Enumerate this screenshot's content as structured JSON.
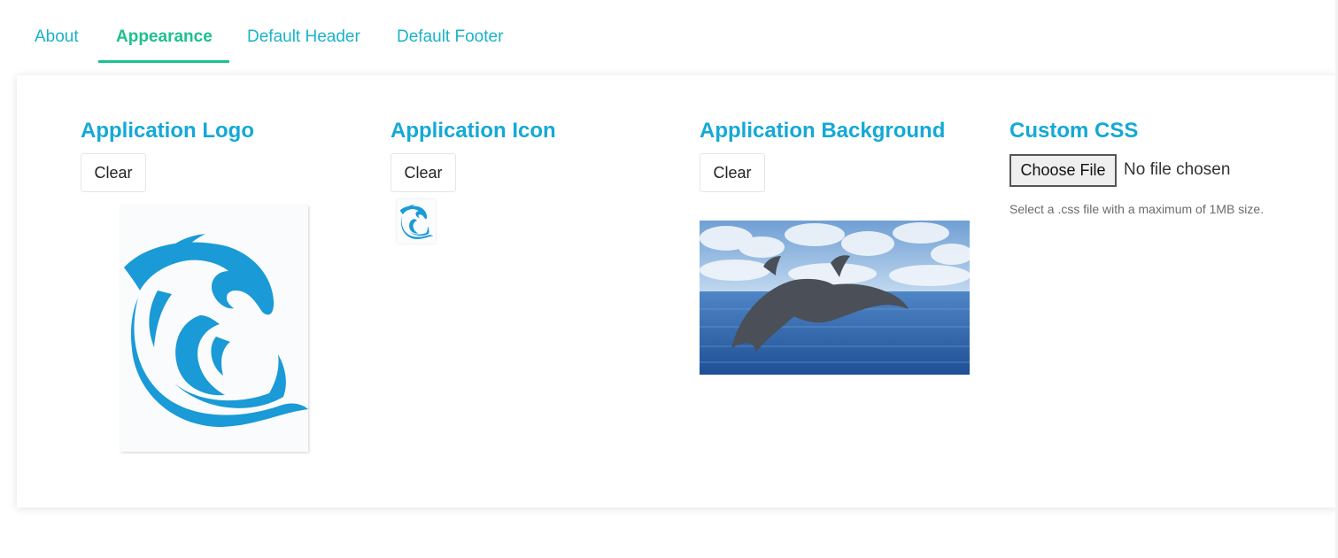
{
  "tabs": [
    {
      "label": "About",
      "active": false
    },
    {
      "label": "Appearance",
      "active": true
    },
    {
      "label": "Default Header",
      "active": false
    },
    {
      "label": "Default Footer",
      "active": false
    }
  ],
  "colors": {
    "tab_inactive": "#1ab3c8",
    "tab_active": "#1dc08f",
    "section_title": "#14a9d6",
    "logo_blue": "#1a9ad6"
  },
  "sections": {
    "logo": {
      "title": "Application Logo",
      "clear_label": "Clear",
      "image_icon": "dolphin-logo-icon"
    },
    "icon": {
      "title": "Application Icon",
      "clear_label": "Clear",
      "image_icon": "dolphin-logo-icon"
    },
    "background": {
      "title": "Application Background",
      "clear_label": "Clear",
      "image_icon": "dolphins-ocean-photo"
    },
    "css": {
      "title": "Custom CSS",
      "file_button_label": "Choose File",
      "file_status": "No file chosen",
      "help_text": "Select a .css file with a maximum of 1MB size."
    }
  }
}
